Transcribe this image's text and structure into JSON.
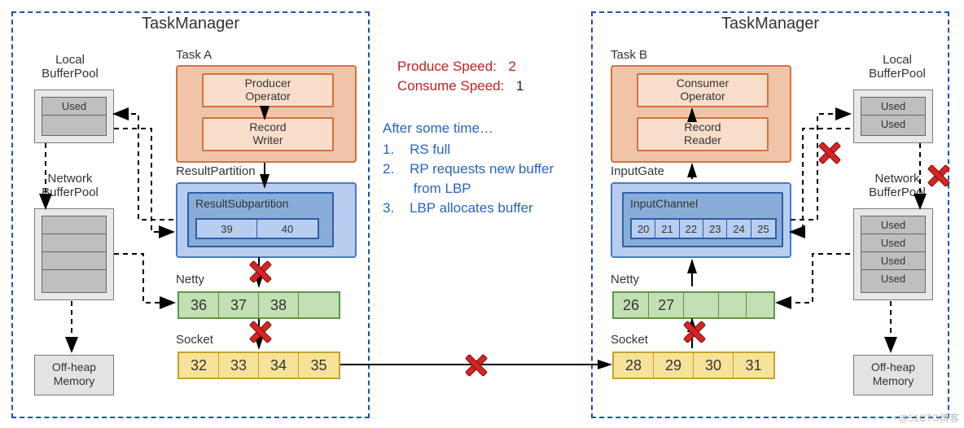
{
  "diagram_type": "flow-diagram",
  "left_tm": {
    "title": "TaskManager",
    "local_bp_label": "Local\nBufferPool",
    "local_bp_rows": [
      "Used",
      ""
    ],
    "network_bp_label": "Network\nBufferPool",
    "network_bp_rows": [
      "",
      "",
      "",
      ""
    ],
    "offheap_label": "Off-heap\nMemory",
    "task_label": "Task A",
    "producer_label": "Producer\nOperator",
    "record_writer_label": "Record\nWriter",
    "result_partition_label": "ResultPartition",
    "result_subpartition_label": "ResultSubpartition",
    "rs_cells": [
      "39",
      "40"
    ],
    "netty_label": "Netty",
    "netty_cells": [
      "36",
      "37",
      "38",
      ""
    ],
    "socket_label": "Socket",
    "socket_cells": [
      "32",
      "33",
      "34",
      "35"
    ]
  },
  "right_tm": {
    "title": "TaskManager",
    "local_bp_label": "Local\nBufferPool",
    "local_bp_rows": [
      "Used",
      "Used"
    ],
    "network_bp_label": "Network\nBufferPool",
    "network_bp_rows": [
      "Used",
      "Used",
      "Used",
      "Used"
    ],
    "offheap_label": "Off-heap\nMemory",
    "task_label": "Task B",
    "consumer_label": "Consumer\nOperator",
    "record_reader_label": "Record\nReader",
    "input_gate_label": "InputGate",
    "input_channel_label": "InputChannel",
    "ic_cells": [
      "20",
      "21",
      "22",
      "23",
      "24",
      "25"
    ],
    "netty_label": "Netty",
    "netty_cells": [
      "26",
      "27",
      "",
      "",
      ""
    ],
    "socket_label": "Socket",
    "socket_cells": [
      "28",
      "29",
      "30",
      "31"
    ]
  },
  "center": {
    "produce_label": "Produce Speed:",
    "produce_value": "2",
    "consume_label": "Consume Speed:",
    "consume_value": "1",
    "after_label": "After some time…",
    "step1": "1.    RS full",
    "step2": "2.    RP requests new buffer",
    "step2b": "        from LBP",
    "step3": "3.    LBP allocates buffer"
  },
  "watermark": "@51CTO博客"
}
